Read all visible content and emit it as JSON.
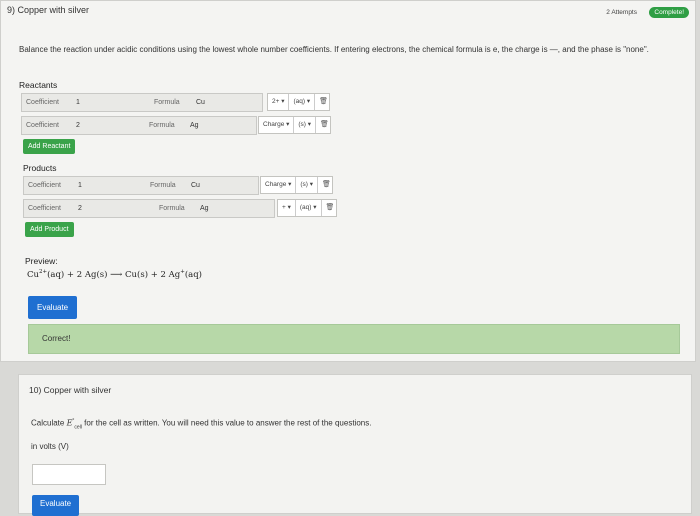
{
  "q9": {
    "title": "9) Copper with silver",
    "attempts": "2 Attempts",
    "status": "Complete!",
    "instructions": "Balance the reaction under acidic conditions using the lowest whole number coefficients. If entering electrons, the chemical formula is e, the charge is —, and the phase is \"none\".",
    "reactants_label": "Reactants",
    "products_label": "Products",
    "coefficient_label": "Coefficient",
    "formula_label": "Formula",
    "reactants": [
      {
        "coefficient": "1",
        "formula": "Cu",
        "charge": "2+ ▾",
        "phase": "(aq) ▾"
      },
      {
        "coefficient": "2",
        "formula": "Ag",
        "charge": "Charge ▾",
        "phase": "(s) ▾"
      }
    ],
    "products": [
      {
        "coefficient": "1",
        "formula": "Cu",
        "charge": "Charge ▾",
        "phase": "(s) ▾"
      },
      {
        "coefficient": "2",
        "formula": "Ag",
        "charge": "+ ▾",
        "phase": "(aq) ▾"
      }
    ],
    "trash_icon": "trash-icon",
    "add_reactant": "Add Reactant",
    "add_product": "Add Product",
    "preview_label": "Preview:",
    "preview": {
      "t1": "Cu",
      "t1_sup": "2+",
      "t2": "(aq) + 2 Ag(s) ⟶ Cu(s) + 2 Ag",
      "t2_sup": "+",
      "t3": "(aq)"
    },
    "evaluate": "Evaluate",
    "correct": "Correct!"
  },
  "q10": {
    "title": "10) Copper with silver",
    "question_pre": "Calculate ",
    "e_symbol": "E",
    "e_sup": "°",
    "e_sub": "cell",
    "question_post": " for the cell as written. You will need this value to answer the rest of the questions.",
    "unit": "in volts (V)",
    "answer_value": "",
    "evaluate": "Evaluate"
  },
  "colors": {
    "complete_green": "#2f9e44",
    "add_button_green": "#3aa34a",
    "evaluate_blue": "#1f6fd1",
    "correct_bg": "#b7d8a8"
  }
}
